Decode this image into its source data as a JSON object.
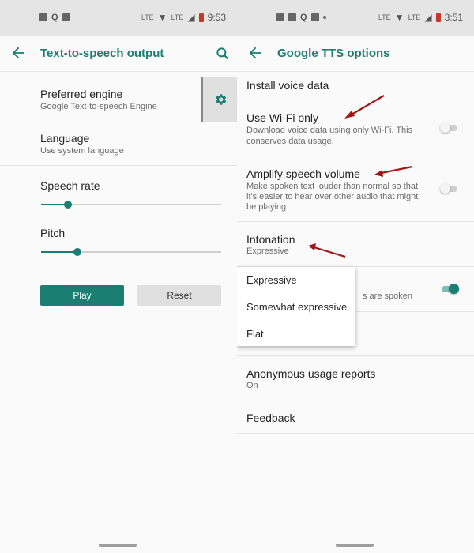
{
  "left": {
    "status": {
      "time": "9:53",
      "net": "LTE",
      "net2": "LTE"
    },
    "app_bar": {
      "title": "Text-to-speech output"
    },
    "preferred_engine": {
      "title": "Preferred engine",
      "subtitle": "Google Text-to-speech Engine"
    },
    "language": {
      "title": "Language",
      "subtitle": "Use system language"
    },
    "speech_rate": {
      "title": "Speech rate",
      "value_percent": 15
    },
    "pitch": {
      "title": "Pitch",
      "value_percent": 20
    },
    "buttons": {
      "play": "Play",
      "reset": "Reset"
    }
  },
  "right": {
    "status": {
      "time": "3:51",
      "net": "LTE",
      "net2": "LTE"
    },
    "app_bar": {
      "title": "Google TTS options"
    },
    "install_voice_data": {
      "title": "Install voice data"
    },
    "wifi_only": {
      "title": "Use Wi-Fi only",
      "subtitle_line1": "Download voice data using only Wi-Fi. This",
      "subtitle_line2": "conserves data usage.",
      "enabled": false
    },
    "amplify": {
      "title": "Amplify speech volume",
      "subtitle_line1": "Make spoken text louder than normal so that",
      "subtitle_line2": "it's easier to hear over other audio that might",
      "subtitle_line3": "be playing",
      "enabled": false
    },
    "intonation": {
      "title": "Intonation",
      "subtitle": "Expressive"
    },
    "hidden_row": {
      "subtitle_fragment": "s are spoken",
      "enabled": true
    },
    "intonation_menu": {
      "options": [
        "Expressive",
        "Somewhat expressive",
        "Flat"
      ]
    },
    "anonymous_usage": {
      "title": "Anonymous usage reports",
      "subtitle": "On"
    },
    "feedback": {
      "title": "Feedback"
    }
  },
  "colors": {
    "accent": "#1a7f72",
    "annotation_arrow": "#a01414",
    "status_bar": "#e5e5e5"
  }
}
